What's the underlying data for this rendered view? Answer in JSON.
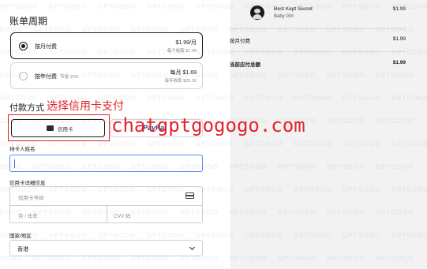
{
  "billing": {
    "title": "账单周期",
    "monthly": {
      "label": "按月付费",
      "price": "$1.99/月",
      "sub": "每个收取 $1.99"
    },
    "yearly": {
      "label": "按年付费",
      "note": "节省 15%",
      "price": "每月 $1.69",
      "sub": "每年收取 $20.30"
    }
  },
  "payment": {
    "title": "付款方式",
    "annotation": "选择信用卡支付",
    "card_tab": "信用卡",
    "paypal_tab": "PayPal",
    "watermark": "chatgptgogogo.com"
  },
  "form": {
    "cardholder_label": "持卡人姓名",
    "card_details_label": "信用卡详细信息",
    "card_number_placeholder": "信用卡号码",
    "expiry_placeholder": "月 / 年年",
    "cvv_placeholder": "CVV 码",
    "country_label": "国家/地区",
    "country_value": "香港"
  },
  "summary": {
    "product_name": "Best Kept Secret",
    "product_artist": "Baby Girl",
    "product_price": "$1.99",
    "monthly_label": "按月付费",
    "monthly_value": "$1.99",
    "total_label": "当前应付总额",
    "total_value": "$1.99"
  },
  "colors": {
    "accent_red": "#e0242b",
    "focus_blue": "#5a8dee",
    "panel_gray": "#f2f2f2"
  },
  "background_watermark": "GPTGOGO"
}
